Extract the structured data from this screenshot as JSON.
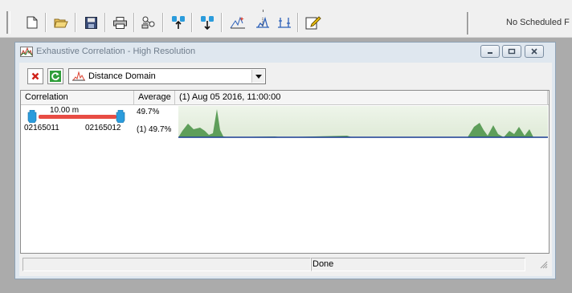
{
  "toolbar": {
    "buttons": [
      {
        "name": "new-icon",
        "glyph": "new-document"
      },
      {
        "name": "open-icon",
        "glyph": "folder-open"
      },
      {
        "name": "save-icon",
        "glyph": "floppy-disk"
      },
      {
        "name": "print-icon",
        "glyph": "printer"
      },
      {
        "name": "network-icon",
        "glyph": "network"
      },
      {
        "name": "sensor-up-icon",
        "glyph": "sensors-up"
      },
      {
        "name": "sensor-down-icon",
        "glyph": "sensors-down"
      },
      {
        "name": "correlate-icon",
        "glyph": "correlation-wand"
      },
      {
        "name": "peak-icon",
        "glyph": "peak-marker"
      },
      {
        "name": "cursor-icon",
        "glyph": "cursor-marker"
      },
      {
        "name": "report-icon",
        "glyph": "edit-report"
      }
    ],
    "schedule_status": "No Scheduled F"
  },
  "window": {
    "title": "Exhaustive Correlation - High Resolution",
    "toolbar": {
      "close_icon": "red-x",
      "refresh_icon": "green-refresh",
      "mode_select_value": "Distance Domain"
    },
    "grid": {
      "columns": [
        "Correlation",
        "Average",
        "(1) Aug 05 2016, 11:00:00"
      ],
      "rows": [
        {
          "distance": "10.00 m",
          "node_a": "02165011",
          "node_b": "02165012",
          "average": "49.7%",
          "average_detail": "(1) 49.7%"
        }
      ]
    },
    "statusbar": {
      "status_text": "Done"
    }
  },
  "colors": {
    "accent_red": "#e84c44",
    "sensor_blue": "#2b9cdc",
    "chart_fill": "#5e9e5a",
    "chart_line": "#1f3f9a"
  }
}
